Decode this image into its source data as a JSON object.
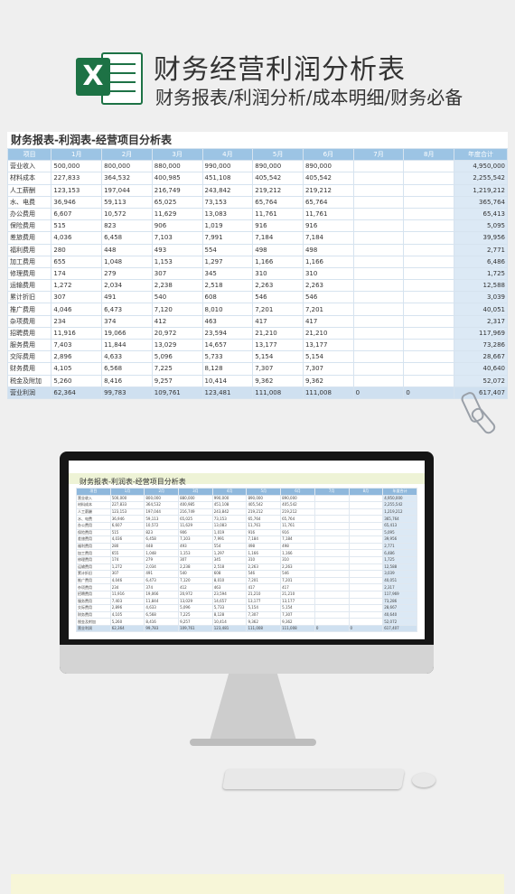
{
  "header": {
    "logo_letter": "X",
    "title": "财务经营利润分析表",
    "subtitle": "财务报表/利润分析/成本明细/财务必备"
  },
  "sheet": {
    "title": "财务报表-利润表-经营项目分析表",
    "columns": [
      "项目",
      "1月",
      "2月",
      "3月",
      "4月",
      "5月",
      "6月",
      "7月",
      "8月",
      "年度合计"
    ],
    "rows": [
      [
        "营业收入",
        "500,000",
        "800,000",
        "880,000",
        "990,000",
        "890,000",
        "890,000",
        "",
        "",
        "4,950,000"
      ],
      [
        "材料成本",
        "227,833",
        "364,532",
        "400,985",
        "451,108",
        "405,542",
        "405,542",
        "",
        "",
        "2,255,542"
      ],
      [
        "人工薪酬",
        "123,153",
        "197,044",
        "216,749",
        "243,842",
        "219,212",
        "219,212",
        "",
        "",
        "1,219,212"
      ],
      [
        "水、电费",
        "36,946",
        "59,113",
        "65,025",
        "73,153",
        "65,764",
        "65,764",
        "",
        "",
        "365,764"
      ],
      [
        "办公费用",
        "6,607",
        "10,572",
        "11,629",
        "13,083",
        "11,761",
        "11,761",
        "",
        "",
        "65,413"
      ],
      [
        "保险费用",
        "515",
        "823",
        "906",
        "1,019",
        "916",
        "916",
        "",
        "",
        "5,095"
      ],
      [
        "差旅费用",
        "4,036",
        "6,458",
        "7,103",
        "7,991",
        "7,184",
        "7,184",
        "",
        "",
        "39,956"
      ],
      [
        "福利费用",
        "280",
        "448",
        "493",
        "554",
        "498",
        "498",
        "",
        "",
        "2,771"
      ],
      [
        "加工费用",
        "655",
        "1,048",
        "1,153",
        "1,297",
        "1,166",
        "1,166",
        "",
        "",
        "6,486"
      ],
      [
        "修理费用",
        "174",
        "279",
        "307",
        "345",
        "310",
        "310",
        "",
        "",
        "1,725"
      ],
      [
        "运输费用",
        "1,272",
        "2,034",
        "2,238",
        "2,518",
        "2,263",
        "2,263",
        "",
        "",
        "12,588"
      ],
      [
        "累计折旧",
        "307",
        "491",
        "540",
        "608",
        "546",
        "546",
        "",
        "",
        "3,039"
      ],
      [
        "推广费用",
        "4,046",
        "6,473",
        "7,120",
        "8,010",
        "7,201",
        "7,201",
        "",
        "",
        "40,051"
      ],
      [
        "杂项费用",
        "234",
        "374",
        "412",
        "463",
        "417",
        "417",
        "",
        "",
        "2,317"
      ],
      [
        "招聘费用",
        "11,916",
        "19,066",
        "20,972",
        "23,594",
        "21,210",
        "21,210",
        "",
        "",
        "117,969"
      ],
      [
        "服务费用",
        "7,403",
        "11,844",
        "13,029",
        "14,657",
        "13,177",
        "13,177",
        "",
        "",
        "73,286"
      ],
      [
        "交际费用",
        "2,896",
        "4,633",
        "5,096",
        "5,733",
        "5,154",
        "5,154",
        "",
        "",
        "28,667"
      ],
      [
        "财务费用",
        "4,105",
        "6,568",
        "7,225",
        "8,128",
        "7,307",
        "7,307",
        "",
        "",
        "40,640"
      ],
      [
        "税金及附加",
        "5,260",
        "8,416",
        "9,257",
        "10,414",
        "9,362",
        "9,362",
        "",
        "",
        "52,072"
      ],
      [
        "营业利润",
        "62,364",
        "99,783",
        "109,761",
        "123,481",
        "111,008",
        "111,008",
        "0",
        "0",
        "617,407"
      ]
    ]
  },
  "colors": {
    "header_blue": "#9cc4e4",
    "total_blue": "#dce9f5",
    "excel_green": "#1d7245"
  }
}
